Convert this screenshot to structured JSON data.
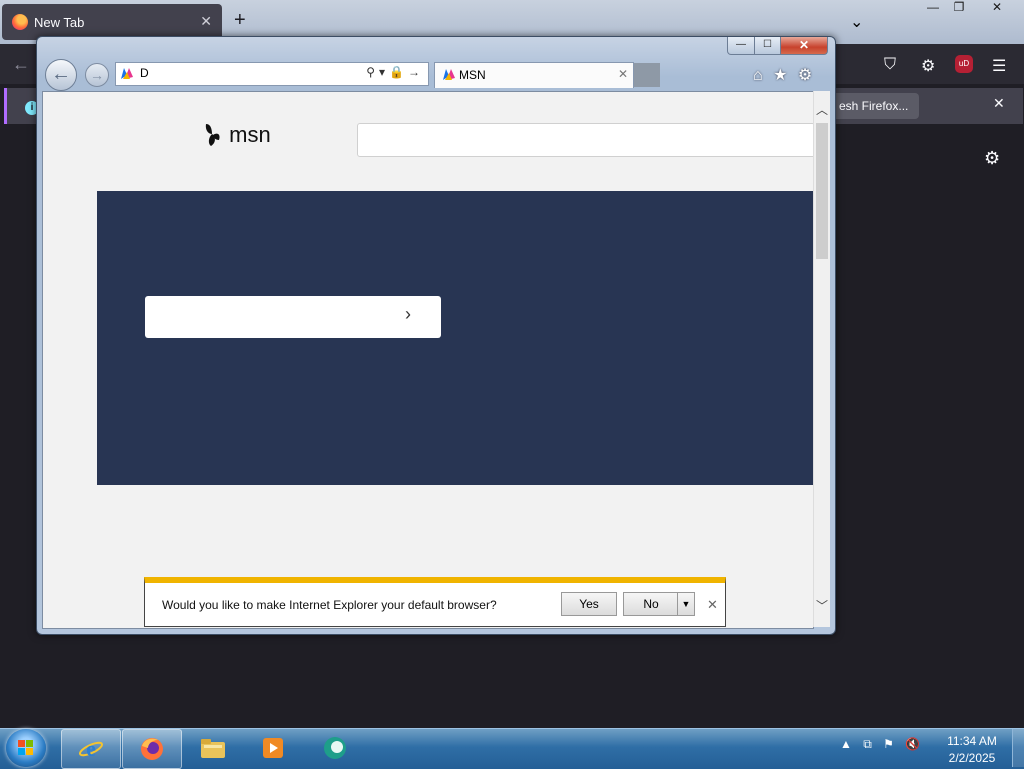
{
  "firefox": {
    "tab_title": "New Tab",
    "tab_close": "✕",
    "new_tab": "+",
    "list_all_tabs": "⌄",
    "win_min": "—",
    "win_restore": "❐",
    "win_close": "✕",
    "back": "←",
    "pocket_icon": "⛉",
    "extensions_icon": "⚙",
    "ublock_label": "uD",
    "menu_icon": "☰",
    "notification_button": "esh Firefox...",
    "notification_close": "✕",
    "settings_icon": "⚙"
  },
  "ie": {
    "address_value": "D",
    "address_tools": "⚲▾🔒→",
    "tab_title": "MSN",
    "tab_close": "✕",
    "win_min": "—",
    "win_max": "☐",
    "win_close": "✕",
    "back": "←",
    "forward": "→",
    "home_icon": "⌂",
    "favorites_icon": "★",
    "tools_icon": "⚙",
    "scroll_up": "︿",
    "scroll_down": "﹀",
    "msn_brand": "msn",
    "hero_chevron": "›",
    "notify": {
      "message": "Would you like to make Internet Explorer your default browser?",
      "yes": "Yes",
      "no": "No",
      "dropdown": "▼",
      "close": "✕"
    }
  },
  "taskbar": {
    "tray": {
      "show_hidden": "▲",
      "network_icon": "⧉",
      "flag_icon": "⚑",
      "volume_icon": "🔇"
    },
    "time": "11:34 AM",
    "date": "2/2/2025"
  },
  "colors": {
    "hero_bg": "#283553",
    "notify_accent": "#f0b400",
    "ff_toolbar": "#2b2a33"
  }
}
